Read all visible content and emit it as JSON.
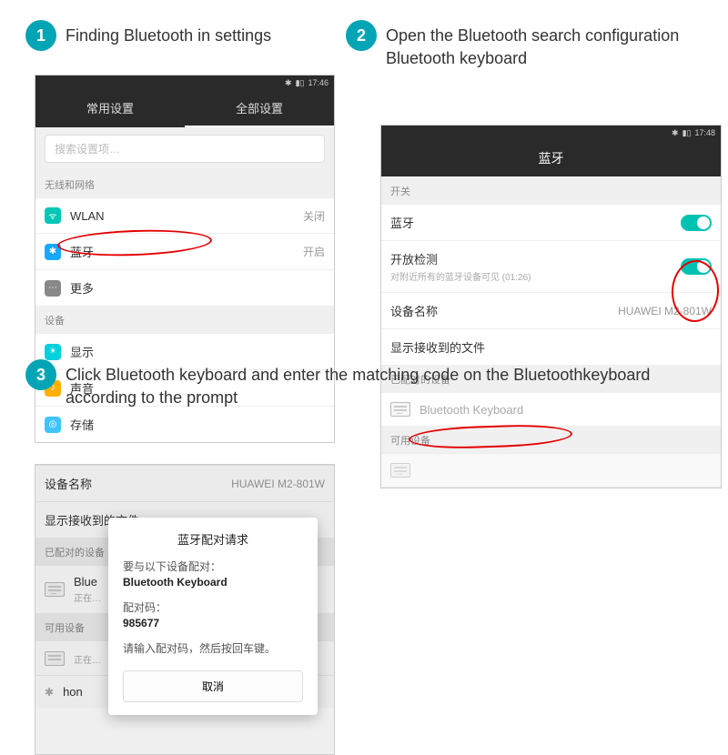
{
  "steps": {
    "s1": {
      "num": "1",
      "text": "Finding Bluetooth in settings"
    },
    "s2": {
      "num": "2",
      "text": "Open the Bluetooth search configuration Bluetooth keyboard"
    },
    "s3": {
      "num": "3",
      "text": "Click Bluetooth keyboard and enter the matching code on the Bluetoothkeyboard according to the prompt"
    }
  },
  "phone1": {
    "time": "17:46",
    "tab1": "常用设置",
    "tab2": "全部设置",
    "search_placeholder": "搜索设置项…",
    "sec_wireless": "无线和网络",
    "wlan": "WLAN",
    "wlan_val": "关闭",
    "bt": "蓝牙",
    "bt_val": "开启",
    "more": "更多",
    "sec_device": "设备",
    "display": "显示",
    "sound": "声音",
    "storage": "存储"
  },
  "phone2": {
    "time": "17:48",
    "title": "蓝牙",
    "sec_switch": "开关",
    "bt": "蓝牙",
    "visibility": "开放检测",
    "visibility_sub": "对附近所有的蓝牙设备可见 (01:26)",
    "devname_label": "设备名称",
    "devname_value": "HUAWEI M2-801W",
    "received": "显示接收到的文件",
    "sec_paired": "已配对的设备",
    "device_kb": "Bluetooth Keyboard",
    "sec_available": "可用设备"
  },
  "phone3": {
    "devname_label": "设备名称",
    "devname_value": "HUAWEI M2-801W",
    "received": "显示接收到的文件",
    "sec_paired": "已配对的设备",
    "row_blue": "Blue",
    "row_blue_sub": "正在…",
    "sec_available": "可用设备",
    "row_av": "正在…",
    "row_hon": "hon",
    "dialog": {
      "title": "蓝牙配对请求",
      "line1": "要与以下设备配对：",
      "line1b": "Bluetooth Keyboard",
      "line2": "配对码：",
      "line2b": "985677",
      "line3": "请输入配对码，然后按回车键。",
      "cancel": "取消"
    }
  }
}
